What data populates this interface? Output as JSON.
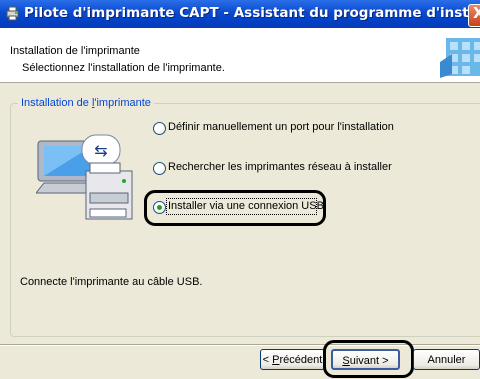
{
  "window": {
    "title": "Pilote d'imprimante CAPT - Assistant du programme d'installation",
    "close_label": "X"
  },
  "header": {
    "title": "Installation de l'imprimante",
    "subtitle": "Sélectionnez l'installation de l'imprimante."
  },
  "group": {
    "label_prefix": "Installation de ",
    "label_accel": "l",
    "label_suffix": "'imprimante",
    "options": [
      {
        "label": "Définir manuellement un port pour l'installation",
        "selected": false
      },
      {
        "label": "Rechercher les imprimantes réseau à installer",
        "selected": false
      },
      {
        "label": "Installer via une connexion USB",
        "selected": true
      }
    ],
    "description": "Connecte l'imprimante au câble USB."
  },
  "buttons": {
    "back": {
      "prefix": "< ",
      "accel": "P",
      "rest": "récédent"
    },
    "next": {
      "accel": "S",
      "rest": "uivant >"
    },
    "cancel": "Annuler"
  },
  "colors": {
    "title_bar": "#0a4ad0",
    "dialog_bg": "#ece9d8",
    "group_label": "#0046d5",
    "radio_selected": "#21a121"
  }
}
